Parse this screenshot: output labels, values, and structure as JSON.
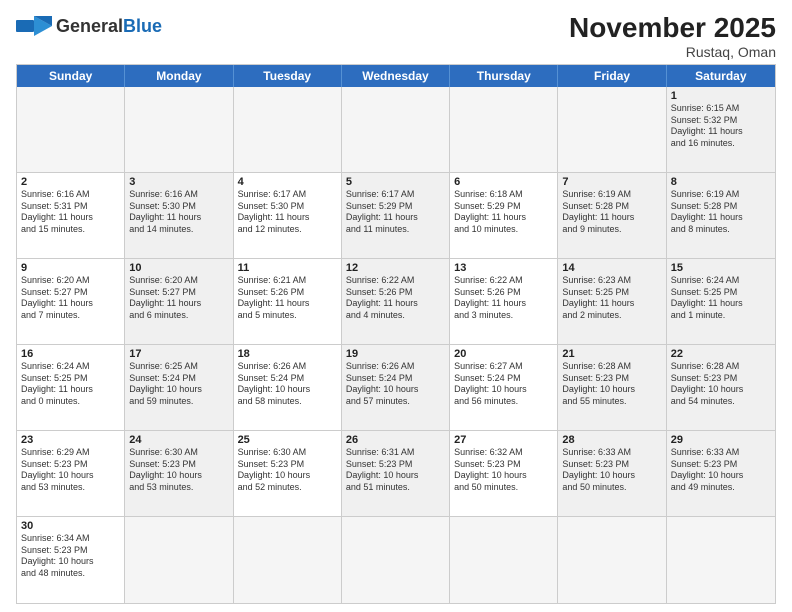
{
  "header": {
    "logo_general": "General",
    "logo_blue": "Blue",
    "month_title": "November 2025",
    "location": "Rustaq, Oman"
  },
  "day_headers": [
    "Sunday",
    "Monday",
    "Tuesday",
    "Wednesday",
    "Thursday",
    "Friday",
    "Saturday"
  ],
  "weeks": [
    [
      {
        "day": "",
        "info": "",
        "empty": true
      },
      {
        "day": "",
        "info": "",
        "empty": true
      },
      {
        "day": "",
        "info": "",
        "empty": true
      },
      {
        "day": "",
        "info": "",
        "empty": true
      },
      {
        "day": "",
        "info": "",
        "empty": true
      },
      {
        "day": "",
        "info": "",
        "empty": true
      },
      {
        "day": "1",
        "info": "Sunrise: 6:15 AM\nSunset: 5:32 PM\nDaylight: 11 hours\nand 16 minutes.",
        "shaded": true
      }
    ],
    [
      {
        "day": "2",
        "info": "Sunrise: 6:16 AM\nSunset: 5:31 PM\nDaylight: 11 hours\nand 15 minutes."
      },
      {
        "day": "3",
        "info": "Sunrise: 6:16 AM\nSunset: 5:30 PM\nDaylight: 11 hours\nand 14 minutes.",
        "shaded": true
      },
      {
        "day": "4",
        "info": "Sunrise: 6:17 AM\nSunset: 5:30 PM\nDaylight: 11 hours\nand 12 minutes."
      },
      {
        "day": "5",
        "info": "Sunrise: 6:17 AM\nSunset: 5:29 PM\nDaylight: 11 hours\nand 11 minutes.",
        "shaded": true
      },
      {
        "day": "6",
        "info": "Sunrise: 6:18 AM\nSunset: 5:29 PM\nDaylight: 11 hours\nand 10 minutes."
      },
      {
        "day": "7",
        "info": "Sunrise: 6:19 AM\nSunset: 5:28 PM\nDaylight: 11 hours\nand 9 minutes.",
        "shaded": true
      },
      {
        "day": "8",
        "info": "Sunrise: 6:19 AM\nSunset: 5:28 PM\nDaylight: 11 hours\nand 8 minutes.",
        "shaded": true
      }
    ],
    [
      {
        "day": "9",
        "info": "Sunrise: 6:20 AM\nSunset: 5:27 PM\nDaylight: 11 hours\nand 7 minutes."
      },
      {
        "day": "10",
        "info": "Sunrise: 6:20 AM\nSunset: 5:27 PM\nDaylight: 11 hours\nand 6 minutes.",
        "shaded": true
      },
      {
        "day": "11",
        "info": "Sunrise: 6:21 AM\nSunset: 5:26 PM\nDaylight: 11 hours\nand 5 minutes."
      },
      {
        "day": "12",
        "info": "Sunrise: 6:22 AM\nSunset: 5:26 PM\nDaylight: 11 hours\nand 4 minutes.",
        "shaded": true
      },
      {
        "day": "13",
        "info": "Sunrise: 6:22 AM\nSunset: 5:26 PM\nDaylight: 11 hours\nand 3 minutes."
      },
      {
        "day": "14",
        "info": "Sunrise: 6:23 AM\nSunset: 5:25 PM\nDaylight: 11 hours\nand 2 minutes.",
        "shaded": true
      },
      {
        "day": "15",
        "info": "Sunrise: 6:24 AM\nSunset: 5:25 PM\nDaylight: 11 hours\nand 1 minute.",
        "shaded": true
      }
    ],
    [
      {
        "day": "16",
        "info": "Sunrise: 6:24 AM\nSunset: 5:25 PM\nDaylight: 11 hours\nand 0 minutes."
      },
      {
        "day": "17",
        "info": "Sunrise: 6:25 AM\nSunset: 5:24 PM\nDaylight: 10 hours\nand 59 minutes.",
        "shaded": true
      },
      {
        "day": "18",
        "info": "Sunrise: 6:26 AM\nSunset: 5:24 PM\nDaylight: 10 hours\nand 58 minutes."
      },
      {
        "day": "19",
        "info": "Sunrise: 6:26 AM\nSunset: 5:24 PM\nDaylight: 10 hours\nand 57 minutes.",
        "shaded": true
      },
      {
        "day": "20",
        "info": "Sunrise: 6:27 AM\nSunset: 5:24 PM\nDaylight: 10 hours\nand 56 minutes."
      },
      {
        "day": "21",
        "info": "Sunrise: 6:28 AM\nSunset: 5:23 PM\nDaylight: 10 hours\nand 55 minutes.",
        "shaded": true
      },
      {
        "day": "22",
        "info": "Sunrise: 6:28 AM\nSunset: 5:23 PM\nDaylight: 10 hours\nand 54 minutes.",
        "shaded": true
      }
    ],
    [
      {
        "day": "23",
        "info": "Sunrise: 6:29 AM\nSunset: 5:23 PM\nDaylight: 10 hours\nand 53 minutes."
      },
      {
        "day": "24",
        "info": "Sunrise: 6:30 AM\nSunset: 5:23 PM\nDaylight: 10 hours\nand 53 minutes.",
        "shaded": true
      },
      {
        "day": "25",
        "info": "Sunrise: 6:30 AM\nSunset: 5:23 PM\nDaylight: 10 hours\nand 52 minutes."
      },
      {
        "day": "26",
        "info": "Sunrise: 6:31 AM\nSunset: 5:23 PM\nDaylight: 10 hours\nand 51 minutes.",
        "shaded": true
      },
      {
        "day": "27",
        "info": "Sunrise: 6:32 AM\nSunset: 5:23 PM\nDaylight: 10 hours\nand 50 minutes."
      },
      {
        "day": "28",
        "info": "Sunrise: 6:33 AM\nSunset: 5:23 PM\nDaylight: 10 hours\nand 50 minutes.",
        "shaded": true
      },
      {
        "day": "29",
        "info": "Sunrise: 6:33 AM\nSunset: 5:23 PM\nDaylight: 10 hours\nand 49 minutes.",
        "shaded": true
      }
    ],
    [
      {
        "day": "30",
        "info": "Sunrise: 6:34 AM\nSunset: 5:23 PM\nDaylight: 10 hours\nand 48 minutes."
      },
      {
        "day": "",
        "info": "",
        "empty": true
      },
      {
        "day": "",
        "info": "",
        "empty": true
      },
      {
        "day": "",
        "info": "",
        "empty": true
      },
      {
        "day": "",
        "info": "",
        "empty": true
      },
      {
        "day": "",
        "info": "",
        "empty": true
      },
      {
        "day": "",
        "info": "",
        "empty": true
      }
    ]
  ]
}
